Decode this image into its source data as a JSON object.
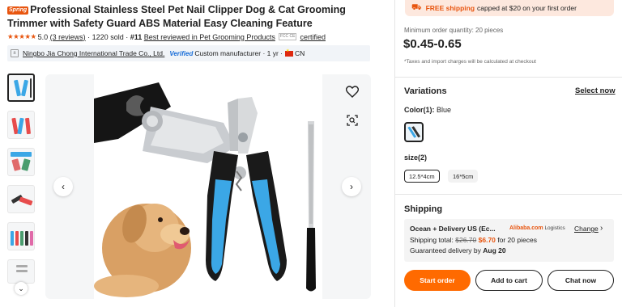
{
  "product": {
    "tag": "Spring",
    "title": "Professional Stainless Steel Pet Nail Clipper Dog & Cat Grooming Trimmer with Safety Guard ABS Material Easy Cleaning Feature"
  },
  "rating": {
    "stars": "★★★★★",
    "score": "5.0",
    "reviews": "(3 reviews)",
    "sold": "· 1220 sold ·",
    "rank": "#11",
    "rank_label": "Best reviewed in Pet Grooming Products",
    "certs": "FCC CE",
    "certified": "certified"
  },
  "supplier": {
    "avatar": "±",
    "name": "Ningbo Jia Chong International Trade Co., Ltd.",
    "verified": "Verified",
    "type": "Custom manufacturer · 1 yr ·",
    "country": "CN"
  },
  "gallery": {
    "thumbs_count": 6
  },
  "banner": {
    "highlight": "FREE shipping",
    "text": "capped at $20 on your first order"
  },
  "pricing": {
    "min_order": "Minimum order quantity: 20 pieces",
    "price": "$0.45-0.65",
    "tax_note": "*Taxes and import charges will be calculated at checkout"
  },
  "variations": {
    "title": "Variations",
    "select_now": "Select now",
    "color_label": "Color(1):",
    "color_value": "Blue",
    "size_label": "size(2)",
    "sizes": [
      "12.5*4cm",
      "16*5cm"
    ]
  },
  "shipping": {
    "title": "Shipping",
    "method": "Ocean + Delivery US (Ec...",
    "logistics_brand": "Alibaba.com",
    "logistics_label": "Logistics",
    "change": "Change",
    "total_label": "Shipping total:",
    "old_price": "$26.70",
    "new_price": "$6.70",
    "qty_text": "for 20 pieces",
    "guarantee_label": "Guaranteed delivery by",
    "guarantee_date": "Aug 20"
  },
  "actions": {
    "start_order": "Start order",
    "add_to_cart": "Add to cart",
    "chat_now": "Chat now"
  },
  "colors": {
    "accent": "#ff6a00",
    "brand_orange": "#e8550f",
    "clipper_blue": "#3ba7e6",
    "verified_blue": "#1a6ed8"
  }
}
